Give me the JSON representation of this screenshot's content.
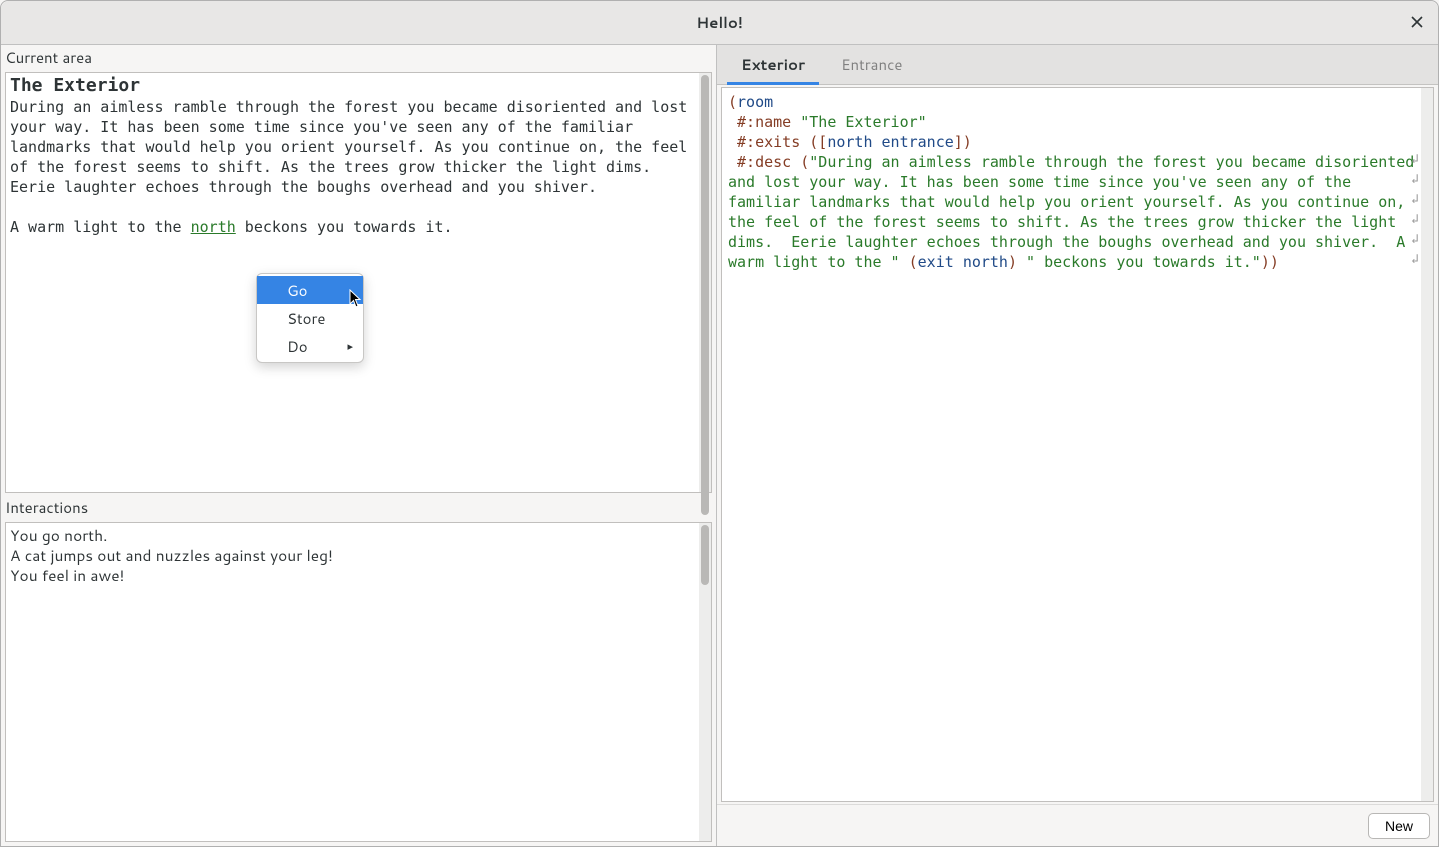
{
  "window": {
    "title": "Hello!"
  },
  "left": {
    "current_area_label": "Current area",
    "room_title": "The Exterior",
    "desc_before_link": "During an aimless ramble through the forest you became disoriented and lost your way. It has been some time since you've seen any of the familiar landmarks that would help you orient yourself. As you continue on, the feel of the forest seems to shift. As the trees grow thicker the light dims.  Eerie laughter echoes through the boughs overhead and you shiver.\n\nA warm light to the ",
    "link_text": "north",
    "desc_after_link": " beckons you towards it.",
    "interactions_label": "Interactions",
    "interactions_text": "You go north.\nA cat jumps out and nuzzles against your leg!\nYou feel in awe!"
  },
  "context_menu": {
    "items": [
      {
        "label": "Go",
        "highlight": true,
        "submenu": false
      },
      {
        "label": "Store",
        "highlight": false,
        "submenu": false
      },
      {
        "label": "Do",
        "highlight": false,
        "submenu": true
      }
    ]
  },
  "right": {
    "tabs": [
      {
        "label": "Exterior",
        "active": true
      },
      {
        "label": "Entrance",
        "active": false
      }
    ],
    "code_tokens": [
      {
        "t": "paren",
        "v": "("
      },
      {
        "t": "sym",
        "v": "room"
      },
      {
        "t": "nl"
      },
      {
        "t": "sp",
        "v": " "
      },
      {
        "t": "kw",
        "v": "#:name"
      },
      {
        "t": "sp",
        "v": " "
      },
      {
        "t": "str",
        "v": "\"The Exterior\""
      },
      {
        "t": "nl"
      },
      {
        "t": "sp",
        "v": " "
      },
      {
        "t": "kw",
        "v": "#:exits"
      },
      {
        "t": "sp",
        "v": " "
      },
      {
        "t": "paren",
        "v": "(["
      },
      {
        "t": "sym",
        "v": "north"
      },
      {
        "t": "sp",
        "v": " "
      },
      {
        "t": "sym",
        "v": "entrance"
      },
      {
        "t": "paren",
        "v": "])"
      },
      {
        "t": "nl"
      },
      {
        "t": "sp",
        "v": " "
      },
      {
        "t": "kw",
        "v": "#:desc"
      },
      {
        "t": "sp",
        "v": " "
      },
      {
        "t": "paren",
        "v": "("
      },
      {
        "t": "str",
        "v": "\"During an aimless ramble through the forest you became disoriented and lost your way. It has been some time since you've seen any of the familiar landmarks that would help you orient yourself. As you continue on, the feel of the forest seems to shift. As the trees grow thicker the light dims.  Eerie laughter echoes through the boughs overhead and you shiver.  A warm light to the \""
      },
      {
        "t": "sp",
        "v": " "
      },
      {
        "t": "paren",
        "v": "("
      },
      {
        "t": "sym",
        "v": "exit"
      },
      {
        "t": "sp",
        "v": " "
      },
      {
        "t": "sym",
        "v": "north"
      },
      {
        "t": "paren",
        "v": ")"
      },
      {
        "t": "sp",
        "v": " "
      },
      {
        "t": "str",
        "v": "\" beckons you towards it.\""
      },
      {
        "t": "paren",
        "v": "))"
      }
    ],
    "new_button": "New"
  }
}
